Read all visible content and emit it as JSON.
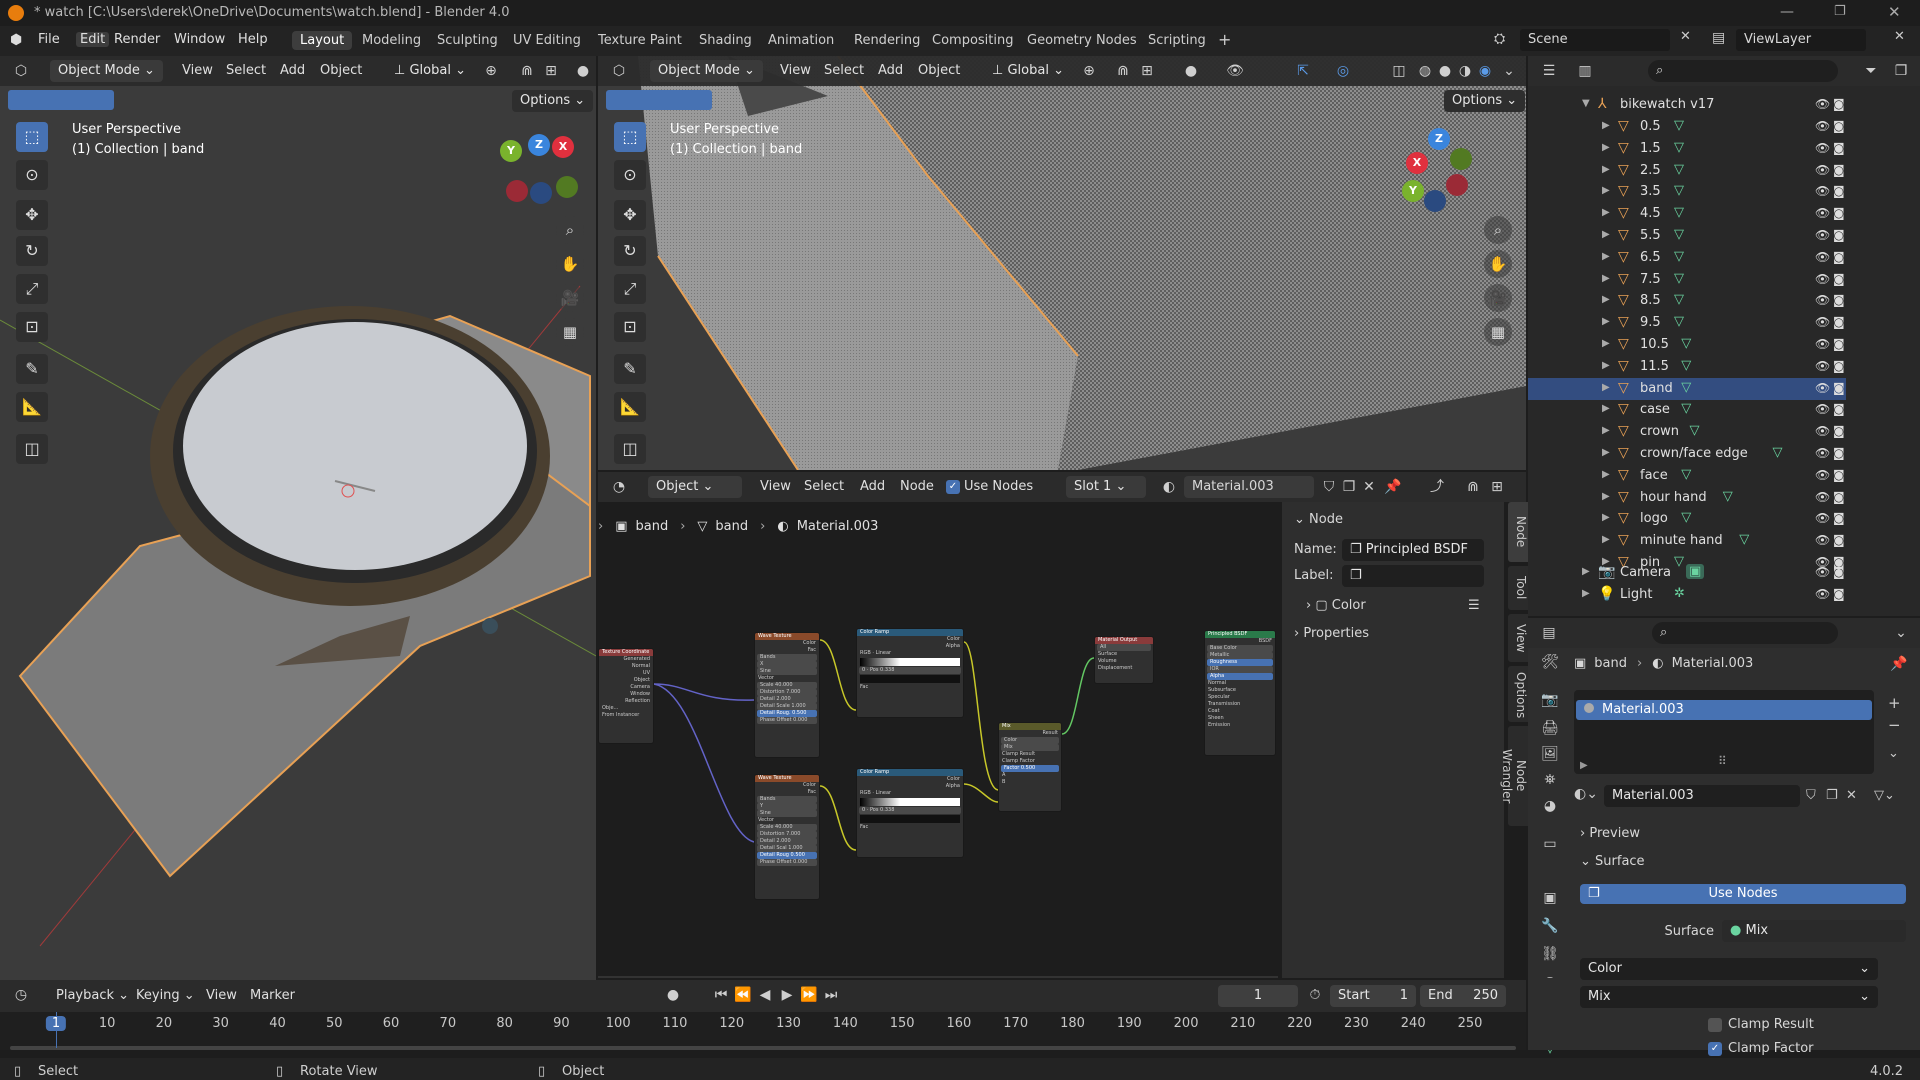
{
  "titlebar": {
    "title": "* watch [C:\\Users\\derek\\OneDrive\\Documents\\watch.blend] - Blender 4.0"
  },
  "menu": [
    "File",
    "Edit",
    "Render",
    "Window",
    "Help"
  ],
  "workspaces": [
    "Layout",
    "Modeling",
    "Sculpting",
    "UV Editing",
    "Texture Paint",
    "Shading",
    "Animation",
    "Rendering",
    "Compositing",
    "Geometry Nodes",
    "Scripting"
  ],
  "scene": {
    "name": "Scene",
    "view_layer": "ViewLayer"
  },
  "viewport_left": {
    "mode": "Object Mode",
    "menus": [
      "View",
      "Select",
      "Add",
      "Object"
    ],
    "transform": "Global",
    "options": "Options",
    "perspective": "User Perspective",
    "collection": "(1) Collection | band"
  },
  "viewport_right": {
    "mode": "Object Mode",
    "menus": [
      "View",
      "Select",
      "Add",
      "Object"
    ],
    "transform": "Global",
    "options": "Options",
    "perspective": "User Perspective",
    "collection": "(1) Collection | band"
  },
  "gizmo": {
    "x": "X",
    "y": "Y",
    "z": "Z",
    "x_color": "#e0303e",
    "y_color": "#7ab32d",
    "z_color": "#3a85dd"
  },
  "node_editor": {
    "type": "Object",
    "menus": [
      "View",
      "Select",
      "Add",
      "Node"
    ],
    "use_nodes": "Use Nodes",
    "slot": "Slot 1",
    "material": "Material.003",
    "breadcrumb": [
      "band",
      "band",
      "Material.003"
    ],
    "panel": {
      "section": "Node",
      "name_label": "Name:",
      "name_value": "Principled BSDF",
      "label_label": "Label:",
      "color": "Color",
      "properties": "Properties"
    },
    "tabs": [
      "Node",
      "Tool",
      "View",
      "Options",
      "Node Wrangler"
    ],
    "nodes": {
      "tex_coord": {
        "title": "Texture Coordinate",
        "rows": [
          "Generated",
          "Normal",
          "UV",
          "Object",
          "Camera",
          "Window",
          "Reflection",
          "Obje...",
          "From Instancer"
        ]
      },
      "wave1": {
        "title": "Wave Texture",
        "rows": [
          "Color",
          "Fac",
          "Bands",
          "X",
          "Sine",
          "Vector",
          "Scale 40.000",
          "Distortion 7.000",
          "Detail 2.000",
          "Detail Scale 1.000",
          "Detail Roug. 0.500",
          "Phase Offset 0.000"
        ]
      },
      "wave2": {
        "title": "Wave Texture",
        "rows": [
          "Color",
          "Fac",
          "Bands",
          "Y",
          "Sine",
          "Vector",
          "Scale 40.000",
          "Distortion 7.000",
          "Detail 2.000",
          "Detail Scal 1.000",
          "Detail Roug 0.500",
          "Phase Offset 0.000"
        ]
      },
      "ramp1": {
        "title": "Color Ramp",
        "rows": [
          "Color",
          "Alpha",
          "RGB",
          "Linear",
          "0",
          "Pos 0.338",
          "Fac"
        ]
      },
      "ramp2": {
        "title": "Color Ramp",
        "rows": [
          "Color",
          "Alpha",
          "RGB",
          "Linear",
          "0",
          "Pos 0.338",
          "Fac"
        ]
      },
      "mix": {
        "title": "Mix",
        "rows": [
          "Result",
          "Color",
          "Mix",
          "Clamp Result",
          "Clamp Factor",
          "Factor 0.500",
          "A",
          "B"
        ]
      },
      "output": {
        "title": "Material Output",
        "rows": [
          "All",
          "Surface",
          "Volume",
          "Displacement"
        ]
      },
      "bsdf": {
        "title": "Principled BSDF",
        "rows": [
          "BSDF",
          "Base Color",
          "Metallic",
          "Roughness",
          "IOR",
          "Alpha",
          "Normal",
          "Subsurface",
          "Specular",
          "Transmission",
          "Coat",
          "Sheen",
          "Emission"
        ]
      }
    }
  },
  "outliner": {
    "root": "bikewatch v17",
    "items": [
      "0.5",
      "1.5",
      "2.5",
      "3.5",
      "4.5",
      "5.5",
      "6.5",
      "7.5",
      "8.5",
      "9.5",
      "10.5",
      "11.5",
      "band",
      "case",
      "crown",
      "crown/face edge",
      "face",
      "hour hand",
      "logo",
      "minute hand",
      "pin"
    ],
    "selected": "band",
    "extras": [
      "Camera",
      "Light"
    ]
  },
  "properties": {
    "breadcrumb": [
      "band",
      "Material.003"
    ],
    "slot": "Material.003",
    "material": "Material.003",
    "preview": "Preview",
    "surface_section": "Surface",
    "use_nodes": "Use Nodes",
    "surface_label": "Surface",
    "surface_value": "Mix",
    "color_dropdown": "Color",
    "mix_dropdown": "Mix",
    "clamp_result": "Clamp Result",
    "clamp_factor": "Clamp Factor"
  },
  "timeline": {
    "menus": [
      "Playback",
      "Keying",
      "View",
      "Marker"
    ],
    "current": "1",
    "start_label": "Start",
    "start": "1",
    "end_label": "End",
    "end": "250",
    "ticks": [
      "1",
      "10",
      "20",
      "30",
      "40",
      "50",
      "60",
      "70",
      "80",
      "90",
      "100",
      "110",
      "120",
      "130",
      "140",
      "150",
      "160",
      "170",
      "180",
      "190",
      "200",
      "210",
      "220",
      "230",
      "240",
      "250"
    ]
  },
  "statusbar": {
    "select": "Select",
    "rotate": "Rotate View",
    "object": "Object",
    "version": "4.0.2"
  },
  "colors": {
    "accent": "#4772b3",
    "selection_orange": "#e8a155"
  }
}
